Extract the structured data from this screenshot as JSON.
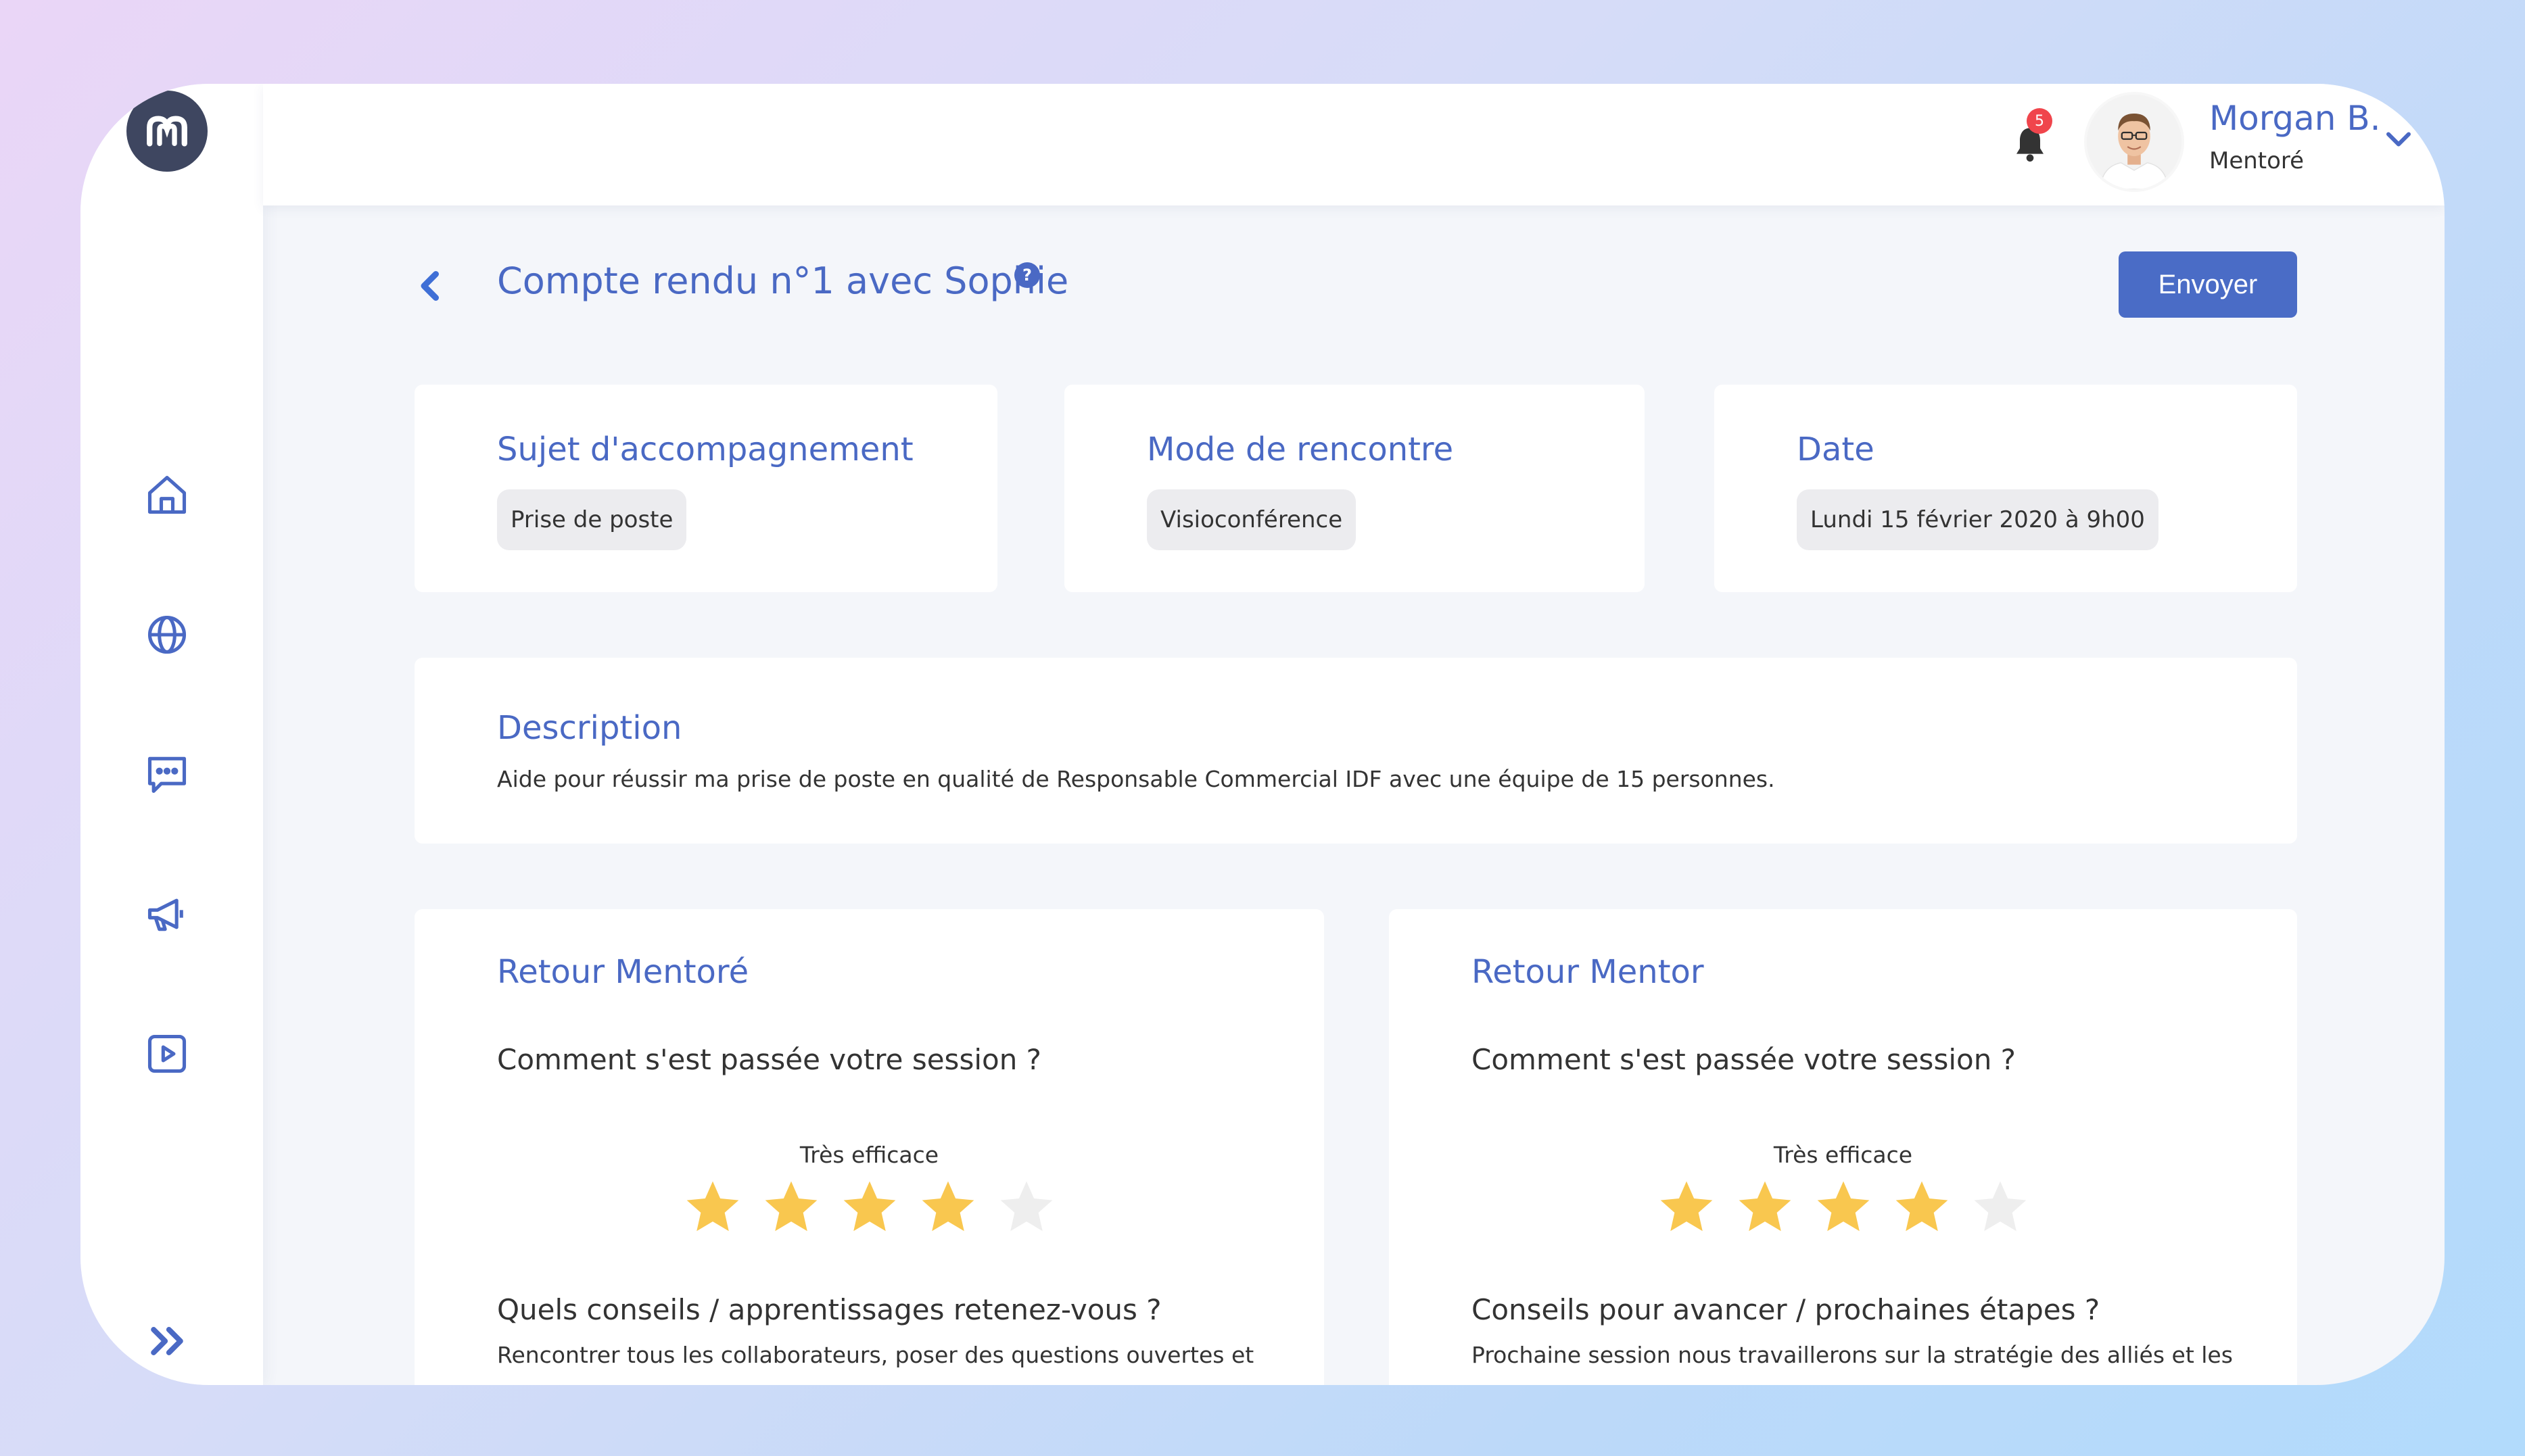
{
  "header": {
    "notifications_count": "5",
    "user_name": "Morgan B.",
    "user_role": "Mentoré"
  },
  "page": {
    "title": "Compte rendu n°1 avec  Sophie",
    "help_symbol": "?",
    "send_label": "Envoyer"
  },
  "info_cards": {
    "subject": {
      "title": "Sujet d'accompagnement",
      "value": "Prise de poste"
    },
    "mode": {
      "title": "Mode de rencontre",
      "value": "Visioconférence"
    },
    "date": {
      "title": "Date",
      "value": "Lundi 15 février 2020 à 9h00"
    }
  },
  "description": {
    "title": "Description",
    "text": "Aide pour réussir ma prise de poste en qualité de Responsable Commercial IDF avec une équipe de 15 personnes."
  },
  "feedback_mentee": {
    "title": "Retour Mentoré",
    "question1": "Comment s'est passée votre session ?",
    "rating_label": "Très efficace",
    "rating": 4,
    "rating_max": 5,
    "question2": "Quels conseils / apprentissages retenez-vous ?",
    "answer2": "Rencontrer tous les collaborateurs, poser des questions ouvertes et"
  },
  "feedback_mentor": {
    "title": "Retour Mentor",
    "question1": "Comment s'est passée votre session ?",
    "rating_label": "Très efficace",
    "rating": 4,
    "rating_max": 5,
    "question2": "Conseils pour avancer / prochaines étapes ?",
    "answer2": "Prochaine session nous travaillerons sur la stratégie des alliés et les"
  },
  "colors": {
    "accent": "#4a69c4",
    "button": "#4a6cc6",
    "star_filled": "#f9c74f",
    "star_empty": "#eeeeee",
    "badge": "#f0454c"
  },
  "icons": {
    "logo": "brand-m-logo",
    "nav": [
      "home-icon",
      "globe-icon",
      "chat-icon",
      "megaphone-icon",
      "video-icon"
    ],
    "expand": "double-chevron-right-icon"
  }
}
